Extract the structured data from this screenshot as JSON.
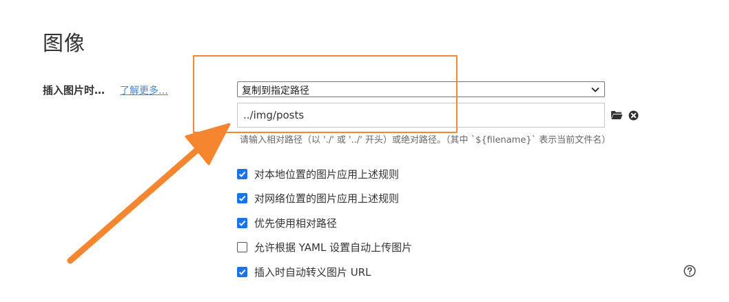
{
  "section": {
    "title": "图像"
  },
  "insert_row": {
    "label": "插入图片时…",
    "learn_more": "了解更多…",
    "select_value": "复制到指定路径",
    "path_value": "../img/posts",
    "hint": "请输入相对路径（以 './' 或 '../' 开头）或绝对路径。（其中 `${filename}` 表示当前文件名）"
  },
  "options": [
    {
      "label": "对本地位置的图片应用上述规则",
      "checked": true
    },
    {
      "label": "对网络位置的图片应用上述规则",
      "checked": true
    },
    {
      "label": "优先使用相对路径",
      "checked": true
    },
    {
      "label": "允许根据 YAML 设置自动上传图片",
      "checked": false
    },
    {
      "label": "插入时自动转义图片 URL",
      "checked": true
    }
  ],
  "colors": {
    "accent": "#1a73e8",
    "link": "#4a86c8",
    "annotation": "#f6852f"
  },
  "icons": [
    "chevron-down-icon",
    "folder-icon",
    "clear-icon",
    "help-icon",
    "check-icon"
  ]
}
